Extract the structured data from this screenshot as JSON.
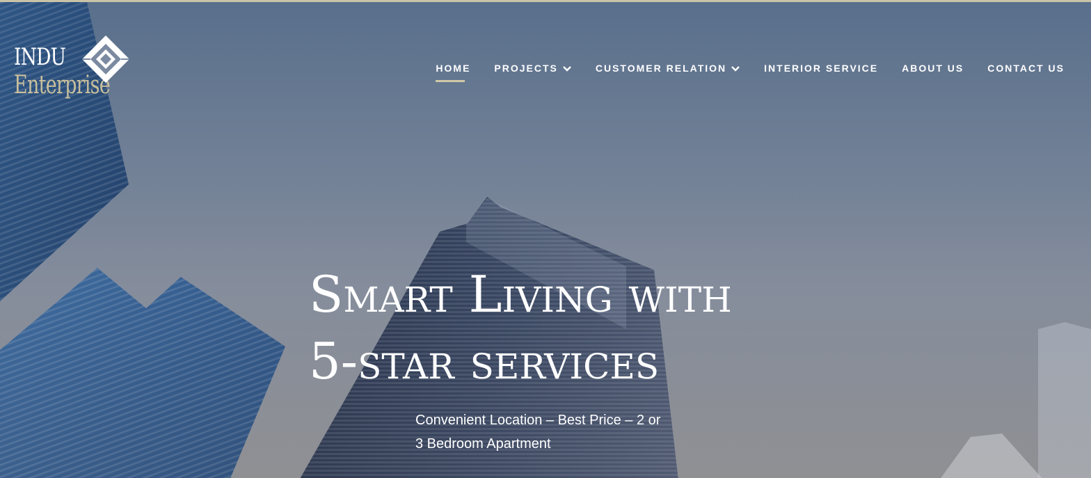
{
  "logo": {
    "line1": "INDU",
    "line2": "Enterprise",
    "mark_icon": "diamond-logo-icon"
  },
  "nav": {
    "items": [
      {
        "label": "HOME",
        "active": true,
        "dropdown": false
      },
      {
        "label": "PROJECTS",
        "active": false,
        "dropdown": true
      },
      {
        "label": "CUSTOMER RELATION",
        "active": false,
        "dropdown": true
      },
      {
        "label": "INTERIOR SERVICE",
        "active": false,
        "dropdown": false
      },
      {
        "label": "ABOUT US",
        "active": false,
        "dropdown": false
      },
      {
        "label": "CONTACT US",
        "active": false,
        "dropdown": false
      }
    ],
    "dropdown_icon": "chevron-down-icon"
  },
  "hero": {
    "headline_line1": "Smart Living with",
    "headline_line2": "5-star services",
    "subtitle": "Convenient Location – Best Price – 2 or 3 Bedroom Apartment"
  },
  "colors": {
    "accent": "#d2c8a8",
    "logo_gold": "#c8bf9c",
    "text": "#ffffff",
    "sky": "#6a7f98"
  }
}
